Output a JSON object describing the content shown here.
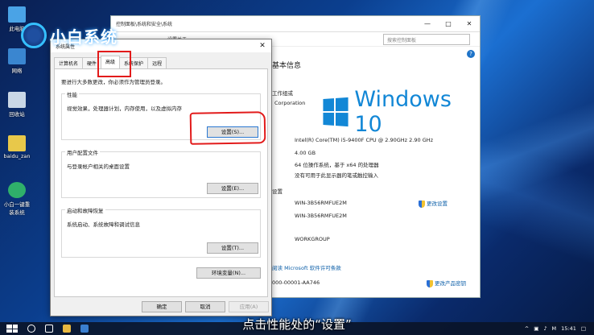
{
  "desktop": {
    "icons": [
      {
        "label": "此电脑"
      },
      {
        "label": "网络"
      },
      {
        "label": "回收站"
      },
      {
        "label": "baidu_zan"
      },
      {
        "label": "小白一键重装系统"
      }
    ]
  },
  "logo": {
    "text": "小白系统"
  },
  "control_panel": {
    "title": "控制面板\\系统和安全\\系统",
    "addr_right": "设置关于",
    "search_placeholder": "搜索控制面板",
    "heading": "基本信息",
    "edition_label": "工作组或",
    "corporation": "Corporation",
    "windows_word": "Windows 10",
    "processor": "Intel(R) Core(TM) i5-9400F CPU @ 2.90GHz   2.90 GHz",
    "memory": "4.00 GB",
    "system_type": "64 位操作系统，基于 x64 的处理器",
    "pen_touch": "没有可用于此显示器的笔或触控输入",
    "section_settings": "设置",
    "computer_name": "WIN-3B56RMFUE2M",
    "full_name": "WIN-3B56RMFUE2M",
    "workgroup": "WORKGROUP",
    "change_settings": "更改设置",
    "license_link": "阅读 Microsoft 软件许可条款",
    "product_id": "000-00001-AA746",
    "change_key": "更改产品密钥"
  },
  "dialog": {
    "title": "系统属性",
    "tabs": [
      "计算机名",
      "硬件",
      "高级",
      "系统保护",
      "远程"
    ],
    "active_tab_index": 2,
    "intro": "要进行大多数更改，你必须作为管理员登录。",
    "perf": {
      "title": "性能",
      "desc": "视觉效果，处理器计划，内存使用，以及虚拟内存",
      "button": "设置(S)..."
    },
    "profile": {
      "title": "用户配置文件",
      "desc": "与登录帐户相关的桌面设置",
      "button": "设置(E)..."
    },
    "startup": {
      "title": "启动和故障恢复",
      "desc": "系统启动、系统故障和调试信息",
      "button": "设置(T)..."
    },
    "env_button": "环境变量(N)...",
    "ok": "确定",
    "cancel": "取消",
    "apply": "应用(A)"
  },
  "taskbar": {
    "time": "15:41",
    "lang": "M"
  },
  "caption": "点击性能处的“设置”",
  "colors": {
    "accent": "#1287d6",
    "annotation": "#e21b1b"
  }
}
